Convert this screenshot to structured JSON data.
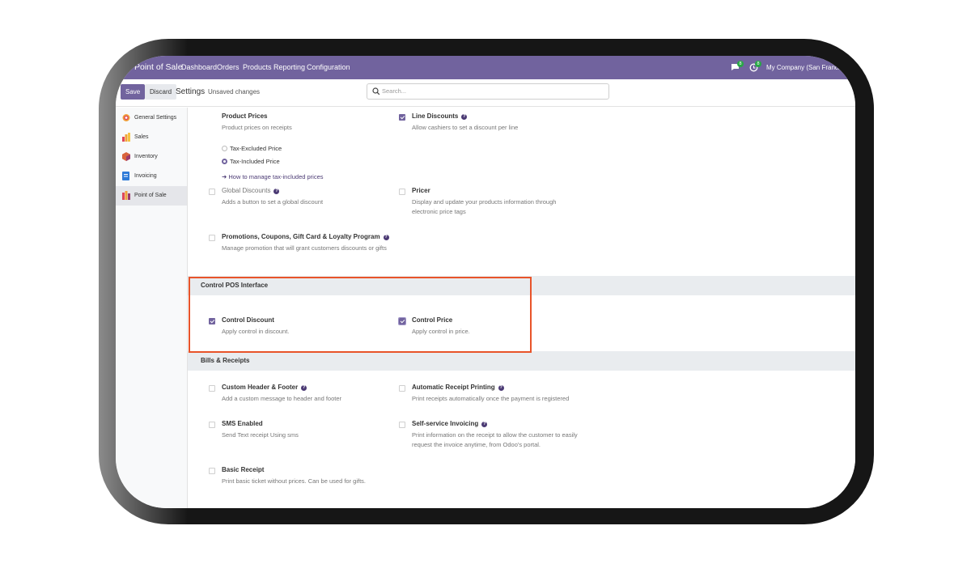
{
  "navbar": {
    "app_name": "Point of Sale",
    "menu": [
      "Dashboard",
      "Orders",
      "Products",
      "Reporting",
      "Configuration"
    ],
    "messages_badge": "8",
    "activities_badge": "8",
    "company": "My Company (San Francisco)"
  },
  "control_panel": {
    "save_label": "Save",
    "discard_label": "Discard",
    "title": "Settings",
    "unsaved": "Unsaved changes",
    "search_placeholder": "Search..."
  },
  "sidebar": {
    "items": [
      {
        "label": "General Settings",
        "icon": "general-settings-icon",
        "active": false
      },
      {
        "label": "Sales",
        "icon": "sales-icon",
        "active": false
      },
      {
        "label": "Inventory",
        "icon": "inventory-icon",
        "active": false
      },
      {
        "label": "Invoicing",
        "icon": "invoicing-icon",
        "active": false
      },
      {
        "label": "Point of Sale",
        "icon": "point-of-sale-icon",
        "active": true
      }
    ]
  },
  "pricing": {
    "product_prices": {
      "title": "Product Prices",
      "desc": "Product prices on receipts"
    },
    "tax_excluded": "Tax-Excluded Price",
    "tax_included": "Tax-Included Price",
    "tax_link": "➜ How to manage tax-included prices",
    "line_discounts": {
      "title": "Line Discounts",
      "desc": "Allow cashiers to set a discount per line",
      "checked": true
    },
    "global_discounts": {
      "title": "Global Discounts",
      "desc": "Adds a button to set a global discount",
      "checked": false
    },
    "pricer": {
      "title": "Pricer",
      "desc": "Display and update your products information through electronic price tags",
      "checked": false
    },
    "promotions": {
      "title": "Promotions, Coupons, Gift Card & Loyalty Program",
      "desc": "Manage promotion that will grant customers discounts or gifts",
      "checked": false
    }
  },
  "control_pos": {
    "header": "Control POS Interface",
    "control_discount": {
      "title": "Control Discount",
      "desc": "Apply control in discount.",
      "checked": true
    },
    "control_price": {
      "title": "Control Price",
      "desc": "Apply control in price.",
      "checked": true
    }
  },
  "bills": {
    "header": "Bills & Receipts",
    "custom_header": {
      "title": "Custom Header & Footer",
      "desc": "Add a custom message to header and footer",
      "checked": false
    },
    "auto_print": {
      "title": "Automatic Receipt Printing",
      "desc": "Print receipts automatically once the payment is registered",
      "checked": false
    },
    "sms": {
      "title": "SMS Enabled",
      "desc": "Send Text receipt Using sms",
      "checked": false
    },
    "self_invoicing": {
      "title": "Self-service Invoicing",
      "desc": "Print information on the receipt to allow the customer to easily request the invoice anytime, from Odoo's portal.",
      "checked": false
    },
    "basic_receipt": {
      "title": "Basic Receipt",
      "desc": "Print basic ticket without prices. Can be used for gifts.",
      "checked": false
    }
  },
  "colors": {
    "brand": "#71639e",
    "highlight": "#e8542a",
    "badge": "#28a745"
  }
}
